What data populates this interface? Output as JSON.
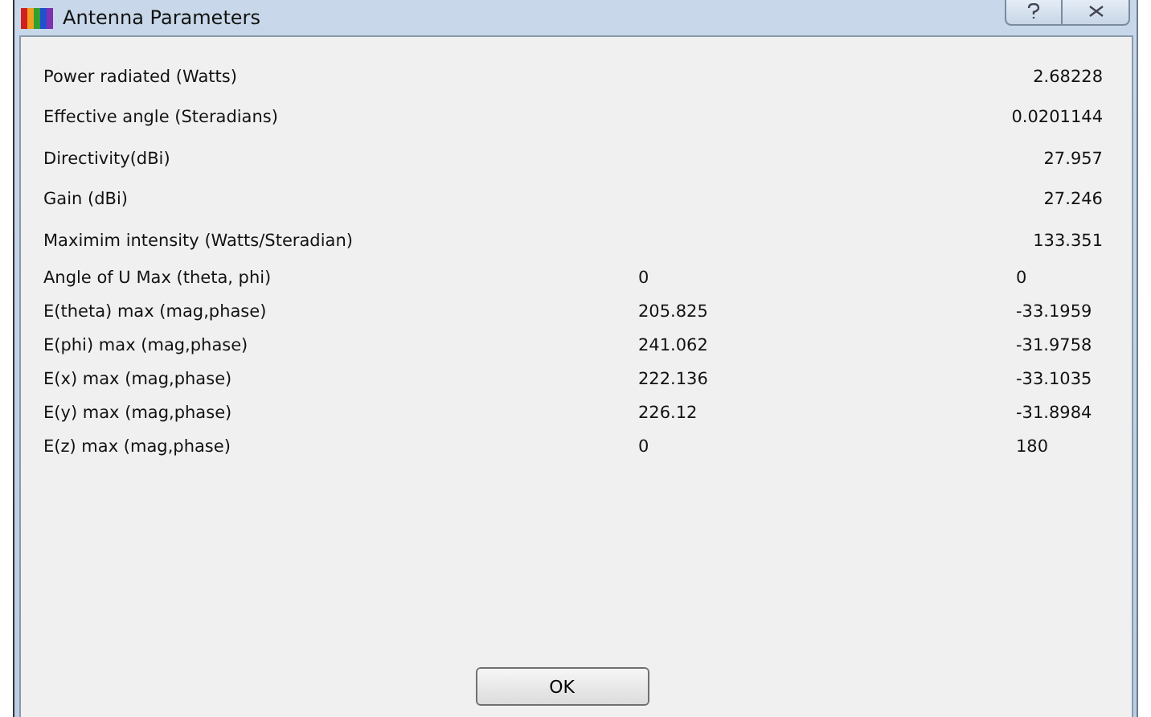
{
  "window": {
    "title": "Antenna Parameters"
  },
  "rows": [
    {
      "kind": "single",
      "label": "Power radiated (Watts)",
      "value": "2.68228"
    },
    {
      "kind": "single",
      "label": "Effective angle (Steradians)",
      "value": "0.0201144"
    },
    {
      "kind": "single",
      "label": "Directivity(dBi)",
      "value": "27.957"
    },
    {
      "kind": "single",
      "label": "Gain (dBi)",
      "value": "27.246"
    },
    {
      "kind": "single",
      "label": "Maximim intensity (Watts/Steradian)",
      "value": "133.351"
    },
    {
      "kind": "pair",
      "label": "Angle of U Max (theta, phi)",
      "value": "0",
      "value_2": "0"
    },
    {
      "kind": "pair",
      "label": "E(theta) max (mag,phase)",
      "value": "205.825",
      "value_2": "-33.1959"
    },
    {
      "kind": "pair",
      "label": "E(phi) max (mag,phase)",
      "value": "241.062",
      "value_2": "-31.9758"
    },
    {
      "kind": "pair",
      "label": "E(x) max (mag,phase)",
      "value": "222.136",
      "value_2": "-33.1035"
    },
    {
      "kind": "pair",
      "label": "E(y) max (mag,phase)",
      "value": "226.12",
      "value_2": "-31.8984"
    },
    {
      "kind": "pair",
      "label": "E(z) max (mag,phase)",
      "value": "0",
      "value_2": "180"
    }
  ],
  "buttons": [
    "OK"
  ]
}
